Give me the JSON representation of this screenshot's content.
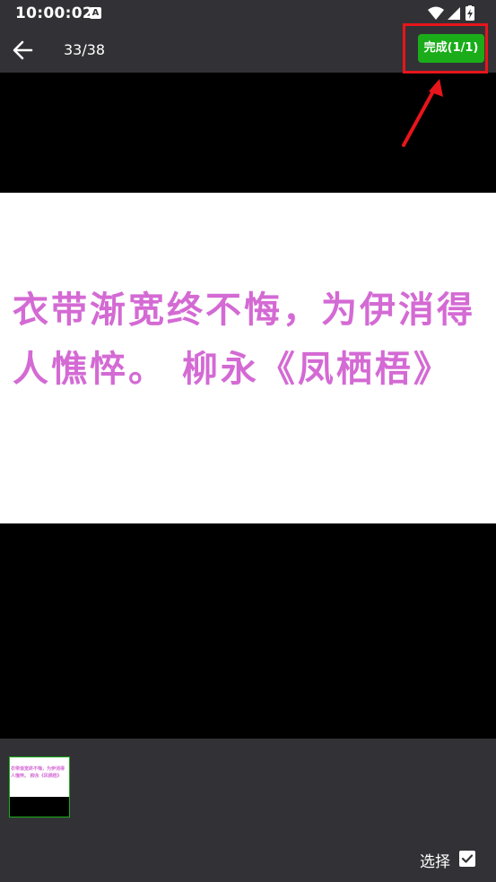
{
  "status_bar": {
    "time": "10:00:02",
    "notification_badge": "A",
    "icons": [
      "wifi-icon",
      "signal-icon",
      "battery-charging-icon"
    ]
  },
  "toolbar": {
    "back_icon": "arrow-left-icon",
    "page_counter": "33/38",
    "done_label": "完成(1/1)"
  },
  "viewer": {
    "image_text": "衣带渐宽终不悔，为伊消得人憔悴。 柳永《凤栖梧》"
  },
  "bottom_bar": {
    "thumbnail_text": "衣带渐宽终不悔，为伊消得人憔悴。 柳永《凤栖梧》",
    "select_label": "选择",
    "select_checked": true
  },
  "colors": {
    "bar_background": "#323236",
    "accent_green": "#1aad19",
    "annotation_red": "#e8151b",
    "poem_text": "#d46ad4"
  }
}
